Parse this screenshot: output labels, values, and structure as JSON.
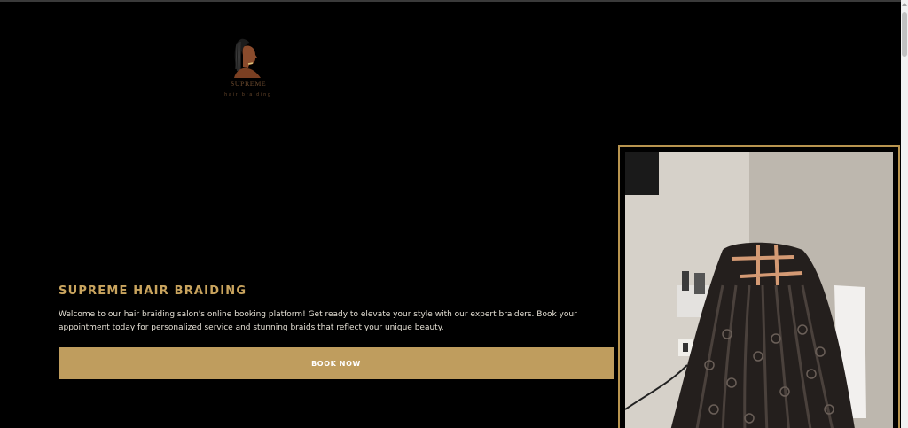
{
  "brand": {
    "name": "SUPREME",
    "tagline": "hair braiding"
  },
  "hero": {
    "title": "SUPREME HAIR BRAIDING",
    "description": "Welcome to our hair braiding salon's online booking platform! Get ready to elevate your style with our expert braiders. Book your appointment today for personalized service and stunning braids that reflect your unique beauty.",
    "cta_label": "BOOK NOW"
  },
  "colors": {
    "background": "#000000",
    "accent_gold": "#bf9d5e",
    "title_gold": "#c9a45e"
  },
  "icons": {
    "logo": "woman-with-braids-silhouette"
  }
}
